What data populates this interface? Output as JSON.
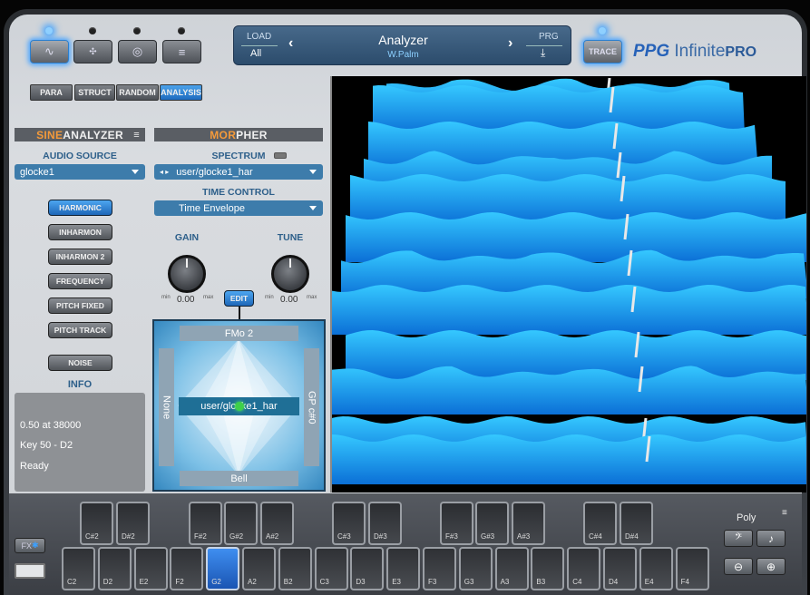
{
  "header": {
    "mode_buttons": [
      {
        "name": "oscillator",
        "icon": "sine-wave-icon",
        "active": true
      },
      {
        "name": "matrix",
        "icon": "grid-icon",
        "active": false
      },
      {
        "name": "sampler",
        "icon": "circle-icon",
        "active": false
      },
      {
        "name": "list",
        "icon": "list-icon",
        "active": false
      }
    ],
    "preset": {
      "load_label": "LOAD",
      "load_value": "All",
      "name": "Analyzer",
      "author": "W.Palm",
      "prg_label": "PRG"
    },
    "trace_label": "TRACE",
    "logo": {
      "brand": "PPG",
      "product": "Infinite",
      "edition": "PRO"
    }
  },
  "tabs": [
    {
      "label": "PARA",
      "active": false
    },
    {
      "label": "STRUCT",
      "active": false
    },
    {
      "label": "RANDOM",
      "active": false
    },
    {
      "label": "ANALYSIS",
      "active": true
    }
  ],
  "sine_analyzer": {
    "title_highlight": "SINE",
    "title_rest": "ANALYZER",
    "audio_source_label": "AUDIO SOURCE",
    "audio_source_value": "glocke1",
    "modes": [
      {
        "label": "HARMONIC",
        "active": true
      },
      {
        "label": "INHARMON"
      },
      {
        "label": "INHARMON 2"
      },
      {
        "label": "FREQUENCY"
      },
      {
        "label": "PITCH FIXED"
      },
      {
        "label": "PITCH TRACK"
      }
    ],
    "noise_label": "NOISE",
    "info_label": "INFO",
    "info_lines": [
      "0.50 at 38000",
      "Key 50 - D2",
      "Ready"
    ]
  },
  "morpher": {
    "title_highlight": "MOR",
    "title_rest": "PHER",
    "spectrum_label": "SPECTRUM",
    "spectrum_value": "user/glocke1_har",
    "time_control_label": "TIME CONTROL",
    "time_control_value": "Time Envelope",
    "gain": {
      "label": "GAIN",
      "value": "0.00",
      "min": "min",
      "max": "max"
    },
    "tune": {
      "label": "TUNE",
      "value": "0.00",
      "min": "min",
      "max": "max"
    },
    "edit_label": "EDIT",
    "pad": {
      "top": "FMo 2",
      "bottom": "Bell",
      "left": "None",
      "right": "GP c#0",
      "center": "user/glocke1_har"
    }
  },
  "keyboard": {
    "white_keys": [
      "C2",
      "D2",
      "E2",
      "F2",
      "G2",
      "A2",
      "B2",
      "C3",
      "D3",
      "E3",
      "F3",
      "G3",
      "A3",
      "B3",
      "C4",
      "D4",
      "E4",
      "F4"
    ],
    "active_key": "G2",
    "black_keys": [
      "C#2",
      "D#2",
      "F#2",
      "G#2",
      "A#2",
      "C#3",
      "D#3",
      "F#3",
      "G#3",
      "A#3",
      "C#4",
      "D#4"
    ],
    "fx_label": "FX",
    "poly_label": "Poly"
  },
  "colors": {
    "accent": "#2f86d8",
    "orange": "#f49a3a",
    "viz": "#1a9be8"
  }
}
